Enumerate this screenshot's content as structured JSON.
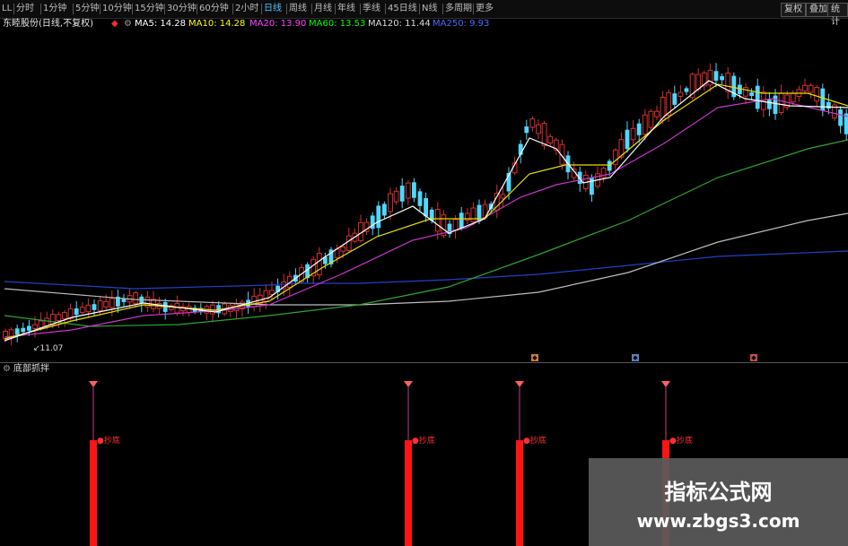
{
  "toolbar": {
    "tabs": [
      {
        "label": "LL",
        "active": false
      },
      {
        "label": "分时",
        "active": false
      },
      {
        "label": "1分钟",
        "active": false
      },
      {
        "label": "5分钟",
        "active": false
      },
      {
        "label": "10分钟",
        "active": false
      },
      {
        "label": "15分钟",
        "active": false
      },
      {
        "label": "30分钟",
        "active": false
      },
      {
        "label": "60分钟",
        "active": false
      },
      {
        "label": "2小时",
        "active": false
      },
      {
        "label": "日线",
        "active": true
      },
      {
        "label": "周线",
        "active": false
      },
      {
        "label": "月线",
        "active": false
      },
      {
        "label": "年线",
        "active": false
      },
      {
        "label": "季线",
        "active": false
      },
      {
        "label": "45日线",
        "active": false
      },
      {
        "label": "N线",
        "active": false
      },
      {
        "label": "多周期",
        "active": false
      },
      {
        "label": "更多",
        "active": false
      }
    ],
    "right_buttons": [
      "复权",
      "叠加",
      "统计"
    ]
  },
  "infobar": {
    "title": "东睦股份(日线,不复权)",
    "ma": [
      {
        "label": "MA5: 14.28",
        "color": "#ffffff"
      },
      {
        "label": "MA10: 14.28",
        "color": "#ffff00"
      },
      {
        "label": "MA20: 13.90",
        "color": "#ff44ff"
      },
      {
        "label": "MA60: 13.53",
        "color": "#00ff00"
      },
      {
        "label": "MA120: 11.44",
        "color": "#cfcfcf"
      },
      {
        "label": "MA250: 9.93",
        "color": "#3b5bff"
      }
    ]
  },
  "indicator": {
    "title": "底部抓拌",
    "signals": [
      {
        "label": "●抄底"
      },
      {
        "label": "●抄底"
      },
      {
        "label": "●抄底"
      },
      {
        "label": "●抄底"
      }
    ]
  },
  "axis_label": "11.07",
  "watermark": {
    "line1": "指标公式网",
    "line2": "www.zbgs3.com"
  },
  "colors": {
    "up": "#d53030",
    "down": "#4fd8ff",
    "signal": "#ff1414",
    "ma5": "#ffffff",
    "ma10": "#e8e000",
    "ma20": "#c836c8",
    "ma60": "#2fa52f",
    "ma120": "#bdbdbd",
    "ma250": "#2040c8"
  }
}
